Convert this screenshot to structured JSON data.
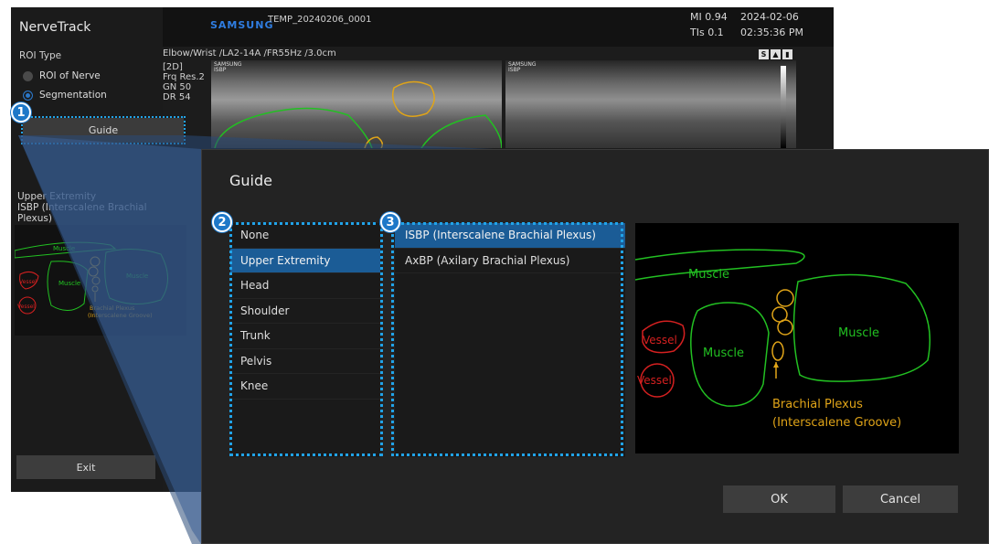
{
  "app": {
    "title": "NerveTrack",
    "roi_type_label": "ROI Type",
    "roi_options": [
      "ROI of Nerve",
      "Segmentation"
    ],
    "roi_selected": "Segmentation",
    "guide_button": "Guide",
    "current_preset_line1": "Upper Extremity",
    "current_preset_line2": "ISBP (Interscalene Brachial Plexus)",
    "exit_button": "Exit"
  },
  "header": {
    "brand": "SAMSUNG",
    "exam_id": "TEMP_20240206_0001",
    "mi": "MI  0.94",
    "tis": "TIs  0.1",
    "date": "2024-02-06",
    "time": "02:35:36 PM",
    "probe_line": "Elbow/Wrist /LA2-14A /FR55Hz /3.0cm",
    "params": [
      "[2D]",
      "Frq  Res.2",
      "GN  50",
      "DR  54",
      "",
      ""
    ]
  },
  "badges": [
    "1",
    "2",
    "3"
  ],
  "dialog": {
    "title": "Guide",
    "categories": [
      "None",
      "Upper Extremity",
      "Head",
      "Shoulder",
      "Trunk",
      "Pelvis",
      "Knee"
    ],
    "selected_category": "Upper Extremity",
    "subitems": [
      "ISBP (Interscalene Brachial Plexus)",
      "AxBP (Axilary Brachial Plexus)"
    ],
    "selected_subitem": "ISBP (Interscalene Brachial Plexus)",
    "ok_button": "OK",
    "cancel_button": "Cancel",
    "diagram_labels": {
      "muscle_top": "Muscle",
      "muscle_left": "Muscle",
      "muscle_right": "Muscle",
      "vessel_1": "Vessel",
      "vessel_2": "Vessel",
      "plexus_line1": "Brachial Plexus",
      "plexus_line2": "(Interscalene Groove)"
    }
  },
  "colors": {
    "accent_blue": "#1e78c8",
    "selection_blue": "#1b5c96",
    "callout_dotted": "#21a3e8",
    "muscle_green": "#22c022",
    "vessel_red": "#d42020",
    "plexus_orange": "#e0a418"
  }
}
